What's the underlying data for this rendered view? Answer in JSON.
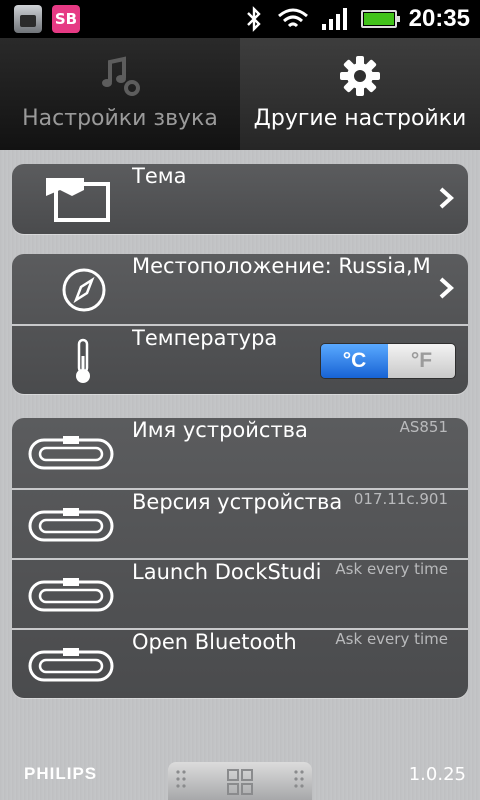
{
  "statusbar": {
    "app_badge": "SB",
    "time": "20:35",
    "icons": [
      "bluetooth-icon",
      "wifi-icon",
      "signal-icon",
      "battery-icon"
    ]
  },
  "tabs": [
    {
      "label": "Настройки звука",
      "icon": "music-settings-icon",
      "active": false
    },
    {
      "label": "Другие настройки",
      "icon": "gear-icon",
      "active": true
    }
  ],
  "groups": {
    "theme": {
      "label": "Тема",
      "icon": "theme-icon"
    },
    "location": {
      "label": "Местоположение: Russia,M",
      "icon": "compass-icon"
    },
    "temperature": {
      "label": "Температура",
      "icon": "thermometer-icon",
      "options": [
        "°C",
        "°F"
      ],
      "selected": "°C"
    },
    "device": [
      {
        "label": "Имя устройства",
        "value": "AS851",
        "icon": "dock-icon"
      },
      {
        "label": "Версия устройства",
        "value": "017.11c.901",
        "icon": "dock-icon"
      },
      {
        "label": "Launch DockStudi",
        "value": "Ask every time",
        "icon": "dock-icon"
      },
      {
        "label": "Open Bluetooth",
        "value": "Ask every time",
        "icon": "dock-icon"
      }
    ]
  },
  "footer": {
    "brand": "PHILIPS",
    "version": "1.0.25"
  },
  "colors": {
    "accent": "#1763d4",
    "background": "#c0c1c3",
    "panel": "#505153"
  }
}
